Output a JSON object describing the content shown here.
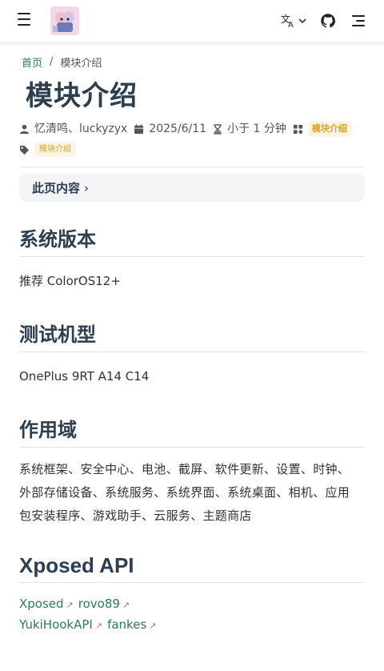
{
  "navbar": {
    "menu_icon": "menu-icon",
    "lang_icon": "translate-icon",
    "github_icon": "github-icon",
    "outline_icon": "outline-icon"
  },
  "breadcrumb": {
    "home": "首页",
    "separator": "/",
    "current": "模块介绍"
  },
  "page": {
    "title": "模块介绍",
    "authors": "忆清鸣、luckyzyx",
    "date": "2025/6/11",
    "reading_time": "小于 1 分钟",
    "category": "模块介绍",
    "tag": "模块介绍"
  },
  "toc": {
    "label": "此页内容",
    "chevron": "›"
  },
  "sections": {
    "version": {
      "heading": "系统版本",
      "text": "推荐 ColorOS12+"
    },
    "device": {
      "heading": "测试机型",
      "text": "OnePlus 9RT A14 C14"
    },
    "scope": {
      "heading": "作用域",
      "lines": [
        "系统框架、安全中心、电池、截屏、软件更新、设置、时钟、",
        "外部存储设备、系统服务、系统界面、系统桌面、相机、应用",
        "包安装程序、游戏助手、云服务、主题商店"
      ]
    },
    "api": {
      "heading": "Xposed API",
      "links": [
        [
          "Xposed",
          "rovo89"
        ],
        [
          "YukiHookAPI",
          "fankes"
        ]
      ],
      "ext_glyph": "↗"
    }
  },
  "colors": {
    "link": "#2e7d4f",
    "tag_bg": "#fdf4e3",
    "tag_text": "#e0a020",
    "text": "#2c3e50"
  }
}
